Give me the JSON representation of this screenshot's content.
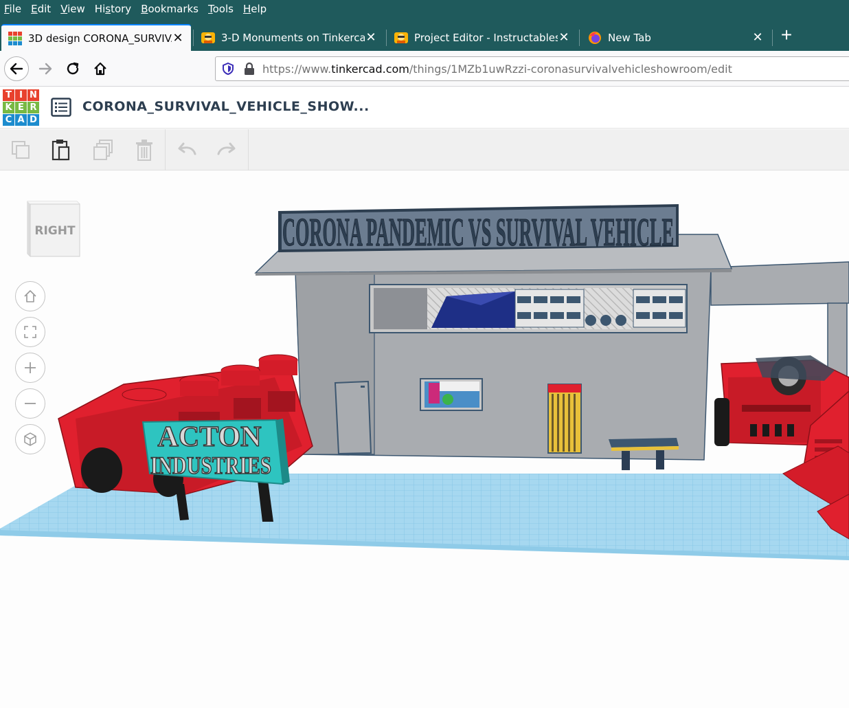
{
  "menu": {
    "items": [
      {
        "key": "F",
        "rest": "ile"
      },
      {
        "key": "E",
        "rest": "dit"
      },
      {
        "key": "V",
        "rest": "iew"
      },
      {
        "pre": "Hi",
        "key": "s",
        "rest": "tory"
      },
      {
        "key": "B",
        "rest": "ookmarks"
      },
      {
        "key": "T",
        "rest": "ools"
      },
      {
        "key": "H",
        "rest": "elp"
      }
    ]
  },
  "tabs": [
    {
      "label": "3D design CORONA_SURVIVAL",
      "icon": "tinkercad-favicon",
      "active": true
    },
    {
      "label": "3-D Monuments on Tinkercad -",
      "icon": "instructables-favicon",
      "active": false
    },
    {
      "label": "Project Editor - Instructables",
      "icon": "instructables-favicon",
      "active": false
    },
    {
      "label": "New Tab",
      "icon": "firefox-favicon",
      "active": false
    }
  ],
  "tab_close_glyph": "✕",
  "new_tab_glyph": "+",
  "url": {
    "scheme": "https://www.",
    "host": "tinkercad.com",
    "path": "/things/1MZb1uwRzzi-coronasurvivalvehicleshowroom/edit"
  },
  "app": {
    "logo_letters": [
      "T",
      "I",
      "N",
      "K",
      "E",
      "R",
      "C",
      "A",
      "D"
    ],
    "logo_colors": [
      "#e8412d",
      "#e8412d",
      "#e8412d",
      "#78b943",
      "#78b943",
      "#78b943",
      "#1d8cce",
      "#1d8cce",
      "#1d8cce"
    ],
    "design_title": "CORONA_SURVIVAL_VEHICLE_SHOW..."
  },
  "toolbar": {
    "tools": [
      "copy-icon",
      "paste-icon",
      "duplicate-icon",
      "delete-icon",
      "undo-icon",
      "redo-icon"
    ]
  },
  "viewcube": {
    "face_label": "RIGHT"
  },
  "view_controls": [
    "home-view-icon",
    "fit-all-icon",
    "zoom-in-icon",
    "zoom-out-icon",
    "perspective-icon"
  ],
  "scene": {
    "banner_text": "CORONA PANDEMIC VS SURVIVAL VEHICLE",
    "sign_line1": "ACTON",
    "sign_line2": "INDUSTRIES",
    "colors": {
      "grid": "#9fd4ee",
      "building": "#a9acb0",
      "vehicle": "#e0202e",
      "sign": "#2ec4c0"
    }
  }
}
